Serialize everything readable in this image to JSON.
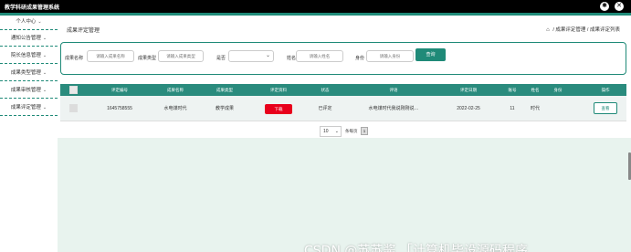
{
  "app": {
    "title": "教学科研成果管理系统"
  },
  "topbar": {
    "icons": [
      "settings-icon",
      "close-icon"
    ]
  },
  "sidebar": {
    "items": [
      {
        "label": "个人中心"
      },
      {
        "label": "通知公告管理"
      },
      {
        "label": "院长信息管理"
      },
      {
        "label": "成果类型管理"
      },
      {
        "label": "成果审核管理"
      },
      {
        "label": "成果评定管理"
      }
    ]
  },
  "page": {
    "title": "成果评定管理",
    "breadcrumb": {
      "home_icon": "home-icon",
      "separator": "/",
      "level1": "成果评定管理",
      "level2": "成果评定列表"
    }
  },
  "search": {
    "fields": [
      {
        "label": "成果名称",
        "placeholder": "请输入成果名称"
      },
      {
        "label": "成果类型",
        "placeholder": "请输入成果类型"
      },
      {
        "label": "是否",
        "value": ""
      },
      {
        "label": "姓名",
        "placeholder": "请输入姓名"
      },
      {
        "label": "身份",
        "placeholder": "请输入身份"
      }
    ],
    "button": "查询"
  },
  "table": {
    "columns": [
      "评定编号",
      "成果名称",
      "成果类型",
      "评定资料",
      "状态",
      "评语",
      "评定日期",
      "账号",
      "姓名",
      "身份",
      "操作"
    ],
    "rows": [
      {
        "number": "1645758555",
        "name": "水电煤时代",
        "type": "教学成果",
        "material": "下载",
        "status": "已评定",
        "comment": "水电煤时代我说刚刚说…",
        "date": "2022-02-25",
        "account": "11",
        "person_name": "时代",
        "identity": "",
        "action": "查看"
      }
    ]
  },
  "pagination": {
    "page_size": "10",
    "total": "条每页",
    "current_page": "1"
  },
  "watermark": "CSDN @苏苏酱 「计算机毕设源码程序",
  "colors": {
    "accent": "#1f8a78",
    "table_header": "#2a8b7d",
    "danger": "#e8001c",
    "footer_bg": "#e8f3ee"
  }
}
